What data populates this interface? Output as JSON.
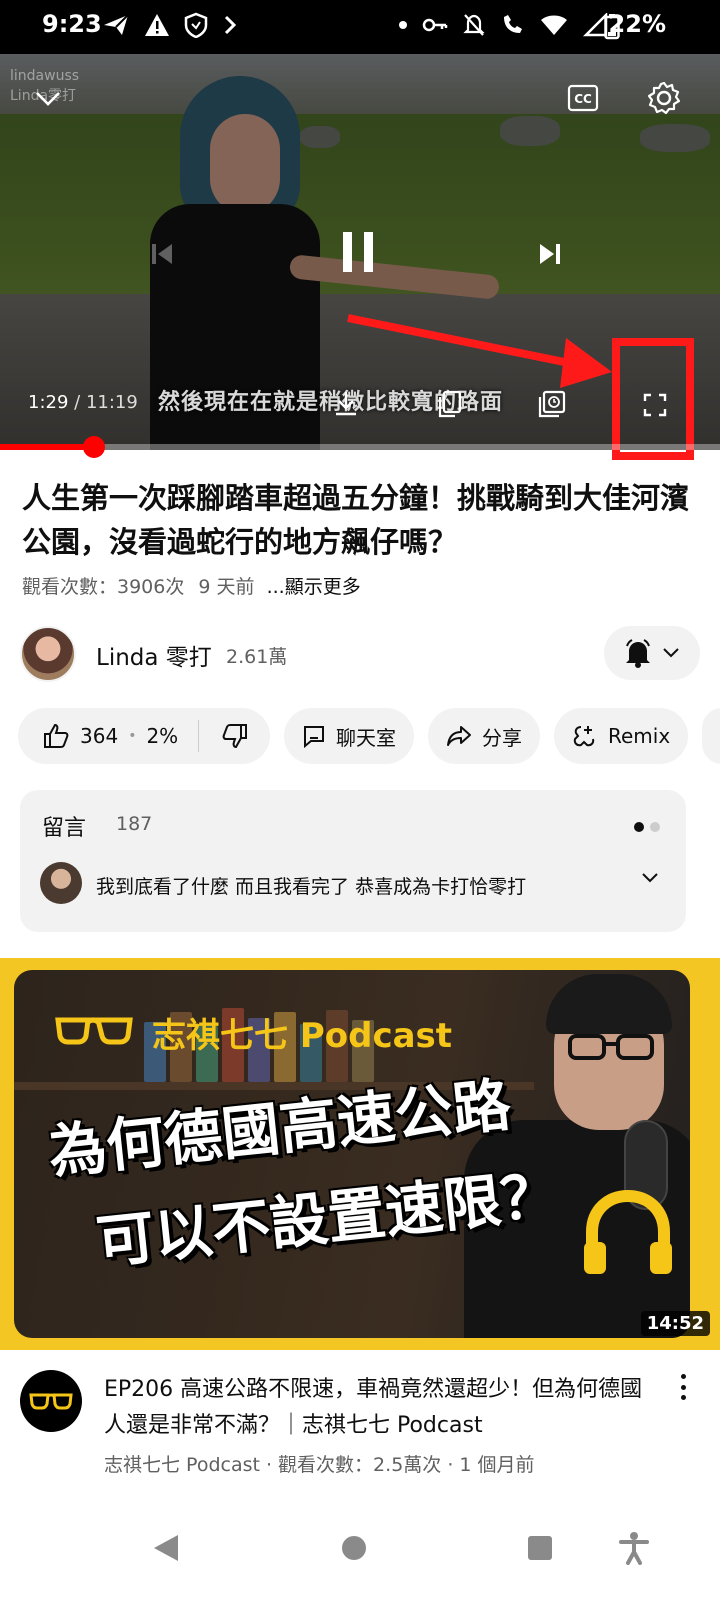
{
  "status_bar": {
    "time": "9:23",
    "battery": "22%"
  },
  "video": {
    "watermark_line1": "lindawuss",
    "watermark_line2": "Linda零打",
    "subtitle": "然後現在在就是稍微比較寬的路面",
    "current_time": "1:29",
    "duration": "/ 11:19",
    "progress_fraction": 0.131,
    "icons": [
      "chevron-down-icon",
      "cc-icon",
      "settings-icon",
      "previous-icon",
      "pause-icon",
      "next-icon",
      "download-icon",
      "copy-icon",
      "playlist-clock-icon",
      "fullscreen-icon"
    ]
  },
  "annotation": {
    "color": "#ff1a1a"
  },
  "title": "人生第一次踩腳踏車超過五分鐘！挑戰騎到大佳河濱公園，沒看過蛇行的地方飆仔嗎？",
  "meta": {
    "views": "觀看次數：3906次",
    "age": "9 天前",
    "more": "...顯示更多"
  },
  "channel": {
    "name": "Linda 零打",
    "subscribers": "2.61萬"
  },
  "actions": {
    "likes": "364",
    "like_ratio": "2%",
    "chat": "聊天室",
    "share": "分享",
    "remix": "Remix"
  },
  "comments": {
    "label": "留言",
    "count": "187",
    "top_comment": "我到底看了什麼 而且我看完了 恭喜成為卡打恰零打"
  },
  "next_video": {
    "thumb_brand": "志祺七七 Podcast",
    "thumb_line1": "為何德國高速公路",
    "thumb_line2": "可以不設置速限？",
    "duration": "14:52",
    "title": "EP206 高速公路不限速，車禍竟然還超少！但為何德國人還是非常不滿？｜志祺七七 Podcast",
    "meta": "志祺七七 Podcast · 觀看次數：2.5萬次 · 1 個月前"
  },
  "colors": {
    "accent": "#ff0000",
    "thumb_yellow": "#f3c623"
  }
}
